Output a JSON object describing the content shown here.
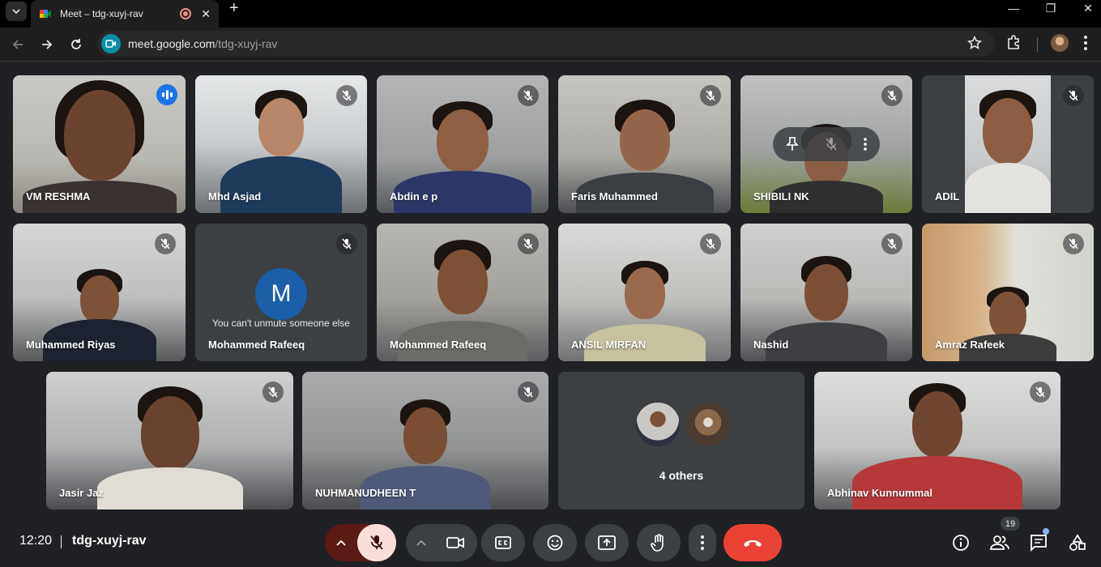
{
  "browser": {
    "tab_title": "Meet – tdg-xuyj-rav",
    "url_host": "meet.google.com",
    "url_path": "/tdg-xuyj-rav"
  },
  "tiles": {
    "t1": "VM RESHMA",
    "t2": "Mhd Asjad",
    "t3": "Abdin e p",
    "t4": "Faris Muhammed",
    "t5": "SHIBILI NK",
    "t6": "ADIL",
    "t7": "Muhammed Riyas",
    "t8": "Mohammed Rafeeq",
    "t8_avatar": "M",
    "t8_message": "You can't unmute someone else",
    "t9": "Mohammed Rafeeq",
    "t10": "ANSIL MIRFAN",
    "t11": "Nashid",
    "t12": "Amraz Rafeek",
    "t13": "Jasir Jaz",
    "t14": "NUHMANUDHEEN T",
    "t15": "4 others",
    "t16": "Abhinav Kunnummal"
  },
  "bottom": {
    "time": "12:20",
    "meeting_code": "tdg-xuyj-rav",
    "participant_count": "19"
  },
  "colors": {
    "accent": "#8ab4f8",
    "end_call": "#ea4335",
    "speaking": "#1a73e8",
    "mic_off": "#f9dedc"
  }
}
